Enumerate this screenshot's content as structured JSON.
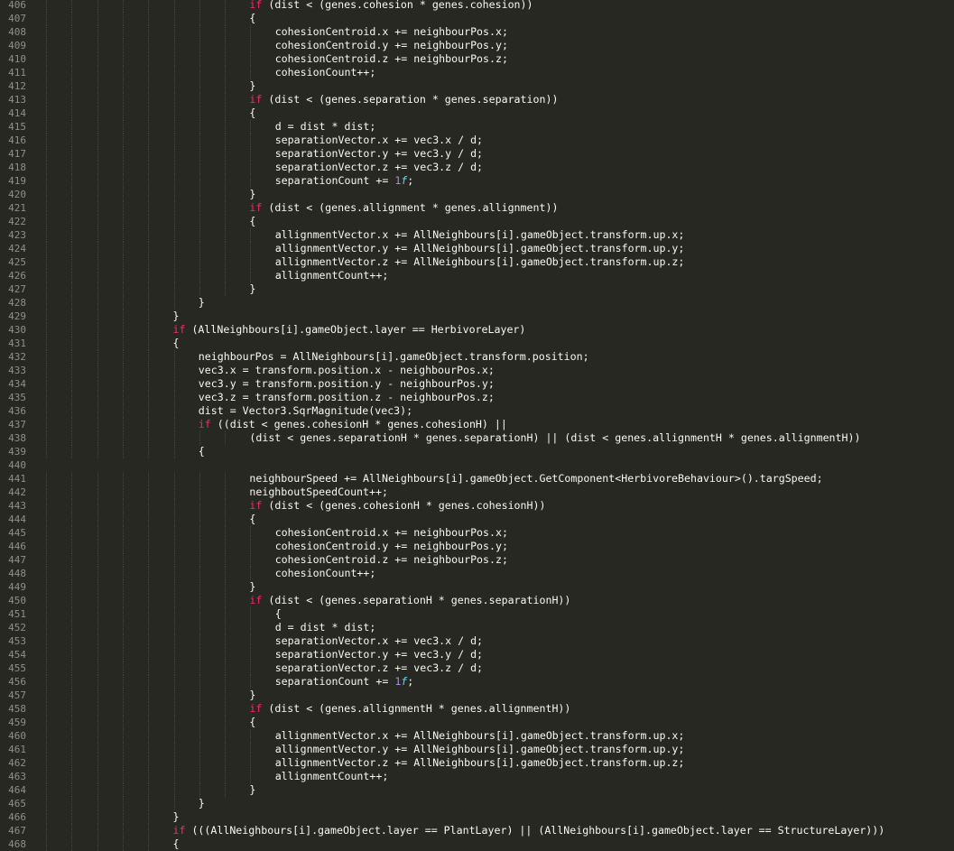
{
  "colors": {
    "background": "#272822",
    "gutter_text": "#90908a",
    "default_text": "#f8f8f2",
    "keyword": "#f92672",
    "number": "#ae81ff",
    "type_suffix": "#66d9ef",
    "indent_guide": "#464741"
  },
  "editor": {
    "lines": [
      {
        "n": "406",
        "segs": [
          [
            "k",
            "if"
          ],
          [
            "p",
            " (dist < (genes.cohesion * genes.cohesion))"
          ]
        ]
      },
      {
        "n": "407",
        "segs": [
          [
            "p",
            "{"
          ]
        ]
      },
      {
        "n": "408",
        "segs": [
          [
            "p",
            "cohesionCentroid.x += neighbourPos.x;"
          ]
        ]
      },
      {
        "n": "409",
        "segs": [
          [
            "p",
            "cohesionCentroid.y += neighbourPos.y;"
          ]
        ]
      },
      {
        "n": "410",
        "segs": [
          [
            "p",
            "cohesionCentroid.z += neighbourPos.z;"
          ]
        ]
      },
      {
        "n": "411",
        "segs": [
          [
            "p",
            "cohesionCount++;"
          ]
        ]
      },
      {
        "n": "412",
        "segs": [
          [
            "p",
            "}"
          ]
        ]
      },
      {
        "n": "413",
        "segs": [
          [
            "k",
            "if"
          ],
          [
            "p",
            " (dist < (genes.separation * genes.separation))"
          ]
        ]
      },
      {
        "n": "414",
        "segs": [
          [
            "p",
            "{"
          ]
        ]
      },
      {
        "n": "415",
        "segs": [
          [
            "p",
            "d = dist * dist;"
          ]
        ]
      },
      {
        "n": "416",
        "segs": [
          [
            "p",
            "separationVector.x += vec3.x / d;"
          ]
        ]
      },
      {
        "n": "417",
        "segs": [
          [
            "p",
            "separationVector.y += vec3.y / d;"
          ]
        ]
      },
      {
        "n": "418",
        "segs": [
          [
            "p",
            "separationVector.z += vec3.z / d;"
          ]
        ]
      },
      {
        "n": "419",
        "segs": [
          [
            "p",
            "separationCount += "
          ],
          [
            "n",
            "1"
          ],
          [
            "t",
            "f"
          ],
          [
            "p",
            ";"
          ]
        ]
      },
      {
        "n": "420",
        "segs": [
          [
            "p",
            "}"
          ]
        ]
      },
      {
        "n": "421",
        "segs": [
          [
            "k",
            "if"
          ],
          [
            "p",
            " (dist < (genes.allignment * genes.allignment))"
          ]
        ]
      },
      {
        "n": "422",
        "segs": [
          [
            "p",
            "{"
          ]
        ]
      },
      {
        "n": "423",
        "segs": [
          [
            "p",
            "allignmentVector.x += AllNeighbours[i].gameObject.transform.up.x;"
          ]
        ]
      },
      {
        "n": "424",
        "segs": [
          [
            "p",
            "allignmentVector.y += AllNeighbours[i].gameObject.transform.up.y;"
          ]
        ]
      },
      {
        "n": "425",
        "segs": [
          [
            "p",
            "allignmentVector.z += AllNeighbours[i].gameObject.transform.up.z;"
          ]
        ]
      },
      {
        "n": "426",
        "segs": [
          [
            "p",
            "allignmentCount++;"
          ]
        ]
      },
      {
        "n": "427",
        "segs": [
          [
            "p",
            "}"
          ]
        ]
      },
      {
        "n": "428",
        "segs": [
          [
            "p",
            "}"
          ]
        ]
      },
      {
        "n": "429",
        "segs": [
          [
            "p",
            "}"
          ]
        ]
      },
      {
        "n": "430",
        "segs": [
          [
            "k",
            "if"
          ],
          [
            "p",
            " (AllNeighbours[i].gameObject.layer == HerbivoreLayer)"
          ]
        ]
      },
      {
        "n": "431",
        "segs": [
          [
            "p",
            "{"
          ]
        ]
      },
      {
        "n": "432",
        "segs": [
          [
            "p",
            "neighbourPos = AllNeighbours[i].gameObject.transform.position;"
          ]
        ]
      },
      {
        "n": "433",
        "segs": [
          [
            "p",
            "vec3.x = transform.position.x - neighbourPos.x;"
          ]
        ]
      },
      {
        "n": "434",
        "segs": [
          [
            "p",
            "vec3.y = transform.position.y - neighbourPos.y;"
          ]
        ]
      },
      {
        "n": "435",
        "segs": [
          [
            "p",
            "vec3.z = transform.position.z - neighbourPos.z;"
          ]
        ]
      },
      {
        "n": "436",
        "segs": [
          [
            "p",
            "dist = Vector3.SqrMagnitude(vec3);"
          ]
        ]
      },
      {
        "n": "437",
        "segs": [
          [
            "k",
            "if"
          ],
          [
            "p",
            " ((dist < genes.cohesionH * genes.cohesionH) ||"
          ]
        ]
      },
      {
        "n": "438",
        "segs": [
          [
            "p",
            "(dist < genes.separationH * genes.separationH) || (dist < genes.allignmentH * genes.allignmentH))"
          ]
        ]
      },
      {
        "n": "439",
        "segs": [
          [
            "p",
            "{"
          ]
        ]
      },
      {
        "n": "440",
        "segs": []
      },
      {
        "n": "441",
        "segs": [
          [
            "p",
            "neighbourSpeed += AllNeighbours[i].gameObject.GetComponent<HerbivoreBehaviour>().targSpeed;"
          ]
        ]
      },
      {
        "n": "442",
        "segs": [
          [
            "p",
            "neighboutSpeedCount++;"
          ]
        ]
      },
      {
        "n": "443",
        "segs": [
          [
            "k",
            "if"
          ],
          [
            "p",
            " (dist < (genes.cohesionH * genes.cohesionH))"
          ]
        ]
      },
      {
        "n": "444",
        "segs": [
          [
            "p",
            "{"
          ]
        ]
      },
      {
        "n": "445",
        "segs": [
          [
            "p",
            "cohesionCentroid.x += neighbourPos.x;"
          ]
        ]
      },
      {
        "n": "446",
        "segs": [
          [
            "p",
            "cohesionCentroid.y += neighbourPos.y;"
          ]
        ]
      },
      {
        "n": "447",
        "segs": [
          [
            "p",
            "cohesionCentroid.z += neighbourPos.z;"
          ]
        ]
      },
      {
        "n": "448",
        "segs": [
          [
            "p",
            "cohesionCount++;"
          ]
        ]
      },
      {
        "n": "449",
        "segs": [
          [
            "p",
            "}"
          ]
        ]
      },
      {
        "n": "450",
        "segs": [
          [
            "k",
            "if"
          ],
          [
            "p",
            " (dist < (genes.separationH * genes.separationH))"
          ]
        ]
      },
      {
        "n": "451",
        "segs": [
          [
            "p",
            "{"
          ]
        ]
      },
      {
        "n": "452",
        "segs": [
          [
            "p",
            "d = dist * dist;"
          ]
        ]
      },
      {
        "n": "453",
        "segs": [
          [
            "p",
            "separationVector.x += vec3.x / d;"
          ]
        ]
      },
      {
        "n": "454",
        "segs": [
          [
            "p",
            "separationVector.y += vec3.y / d;"
          ]
        ]
      },
      {
        "n": "455",
        "segs": [
          [
            "p",
            "separationVector.z += vec3.z / d;"
          ]
        ]
      },
      {
        "n": "456",
        "segs": [
          [
            "p",
            "separationCount += "
          ],
          [
            "n",
            "1"
          ],
          [
            "t",
            "f"
          ],
          [
            "p",
            ";"
          ]
        ]
      },
      {
        "n": "457",
        "segs": [
          [
            "p",
            "}"
          ]
        ]
      },
      {
        "n": "458",
        "segs": [
          [
            "k",
            "if"
          ],
          [
            "p",
            " (dist < (genes.allignmentH * genes.allignmentH))"
          ]
        ]
      },
      {
        "n": "459",
        "segs": [
          [
            "p",
            "{"
          ]
        ]
      },
      {
        "n": "460",
        "segs": [
          [
            "p",
            "allignmentVector.x += AllNeighbours[i].gameObject.transform.up.x;"
          ]
        ]
      },
      {
        "n": "461",
        "segs": [
          [
            "p",
            "allignmentVector.y += AllNeighbours[i].gameObject.transform.up.y;"
          ]
        ]
      },
      {
        "n": "462",
        "segs": [
          [
            "p",
            "allignmentVector.z += AllNeighbours[i].gameObject.transform.up.z;"
          ]
        ]
      },
      {
        "n": "463",
        "segs": [
          [
            "p",
            "allignmentCount++;"
          ]
        ]
      },
      {
        "n": "464",
        "segs": [
          [
            "p",
            "}"
          ]
        ]
      },
      {
        "n": "465",
        "segs": [
          [
            "p",
            "}"
          ]
        ]
      },
      {
        "n": "466",
        "segs": [
          [
            "p",
            "}"
          ]
        ]
      },
      {
        "n": "467",
        "segs": [
          [
            "k",
            "if"
          ],
          [
            "p",
            " (((AllNeighbours[i].gameObject.layer == PlantLayer) || (AllNeighbours[i].gameObject.layer == StructureLayer)))"
          ]
        ]
      },
      {
        "n": "468",
        "segs": [
          [
            "p",
            "{"
          ]
        ]
      }
    ]
  }
}
